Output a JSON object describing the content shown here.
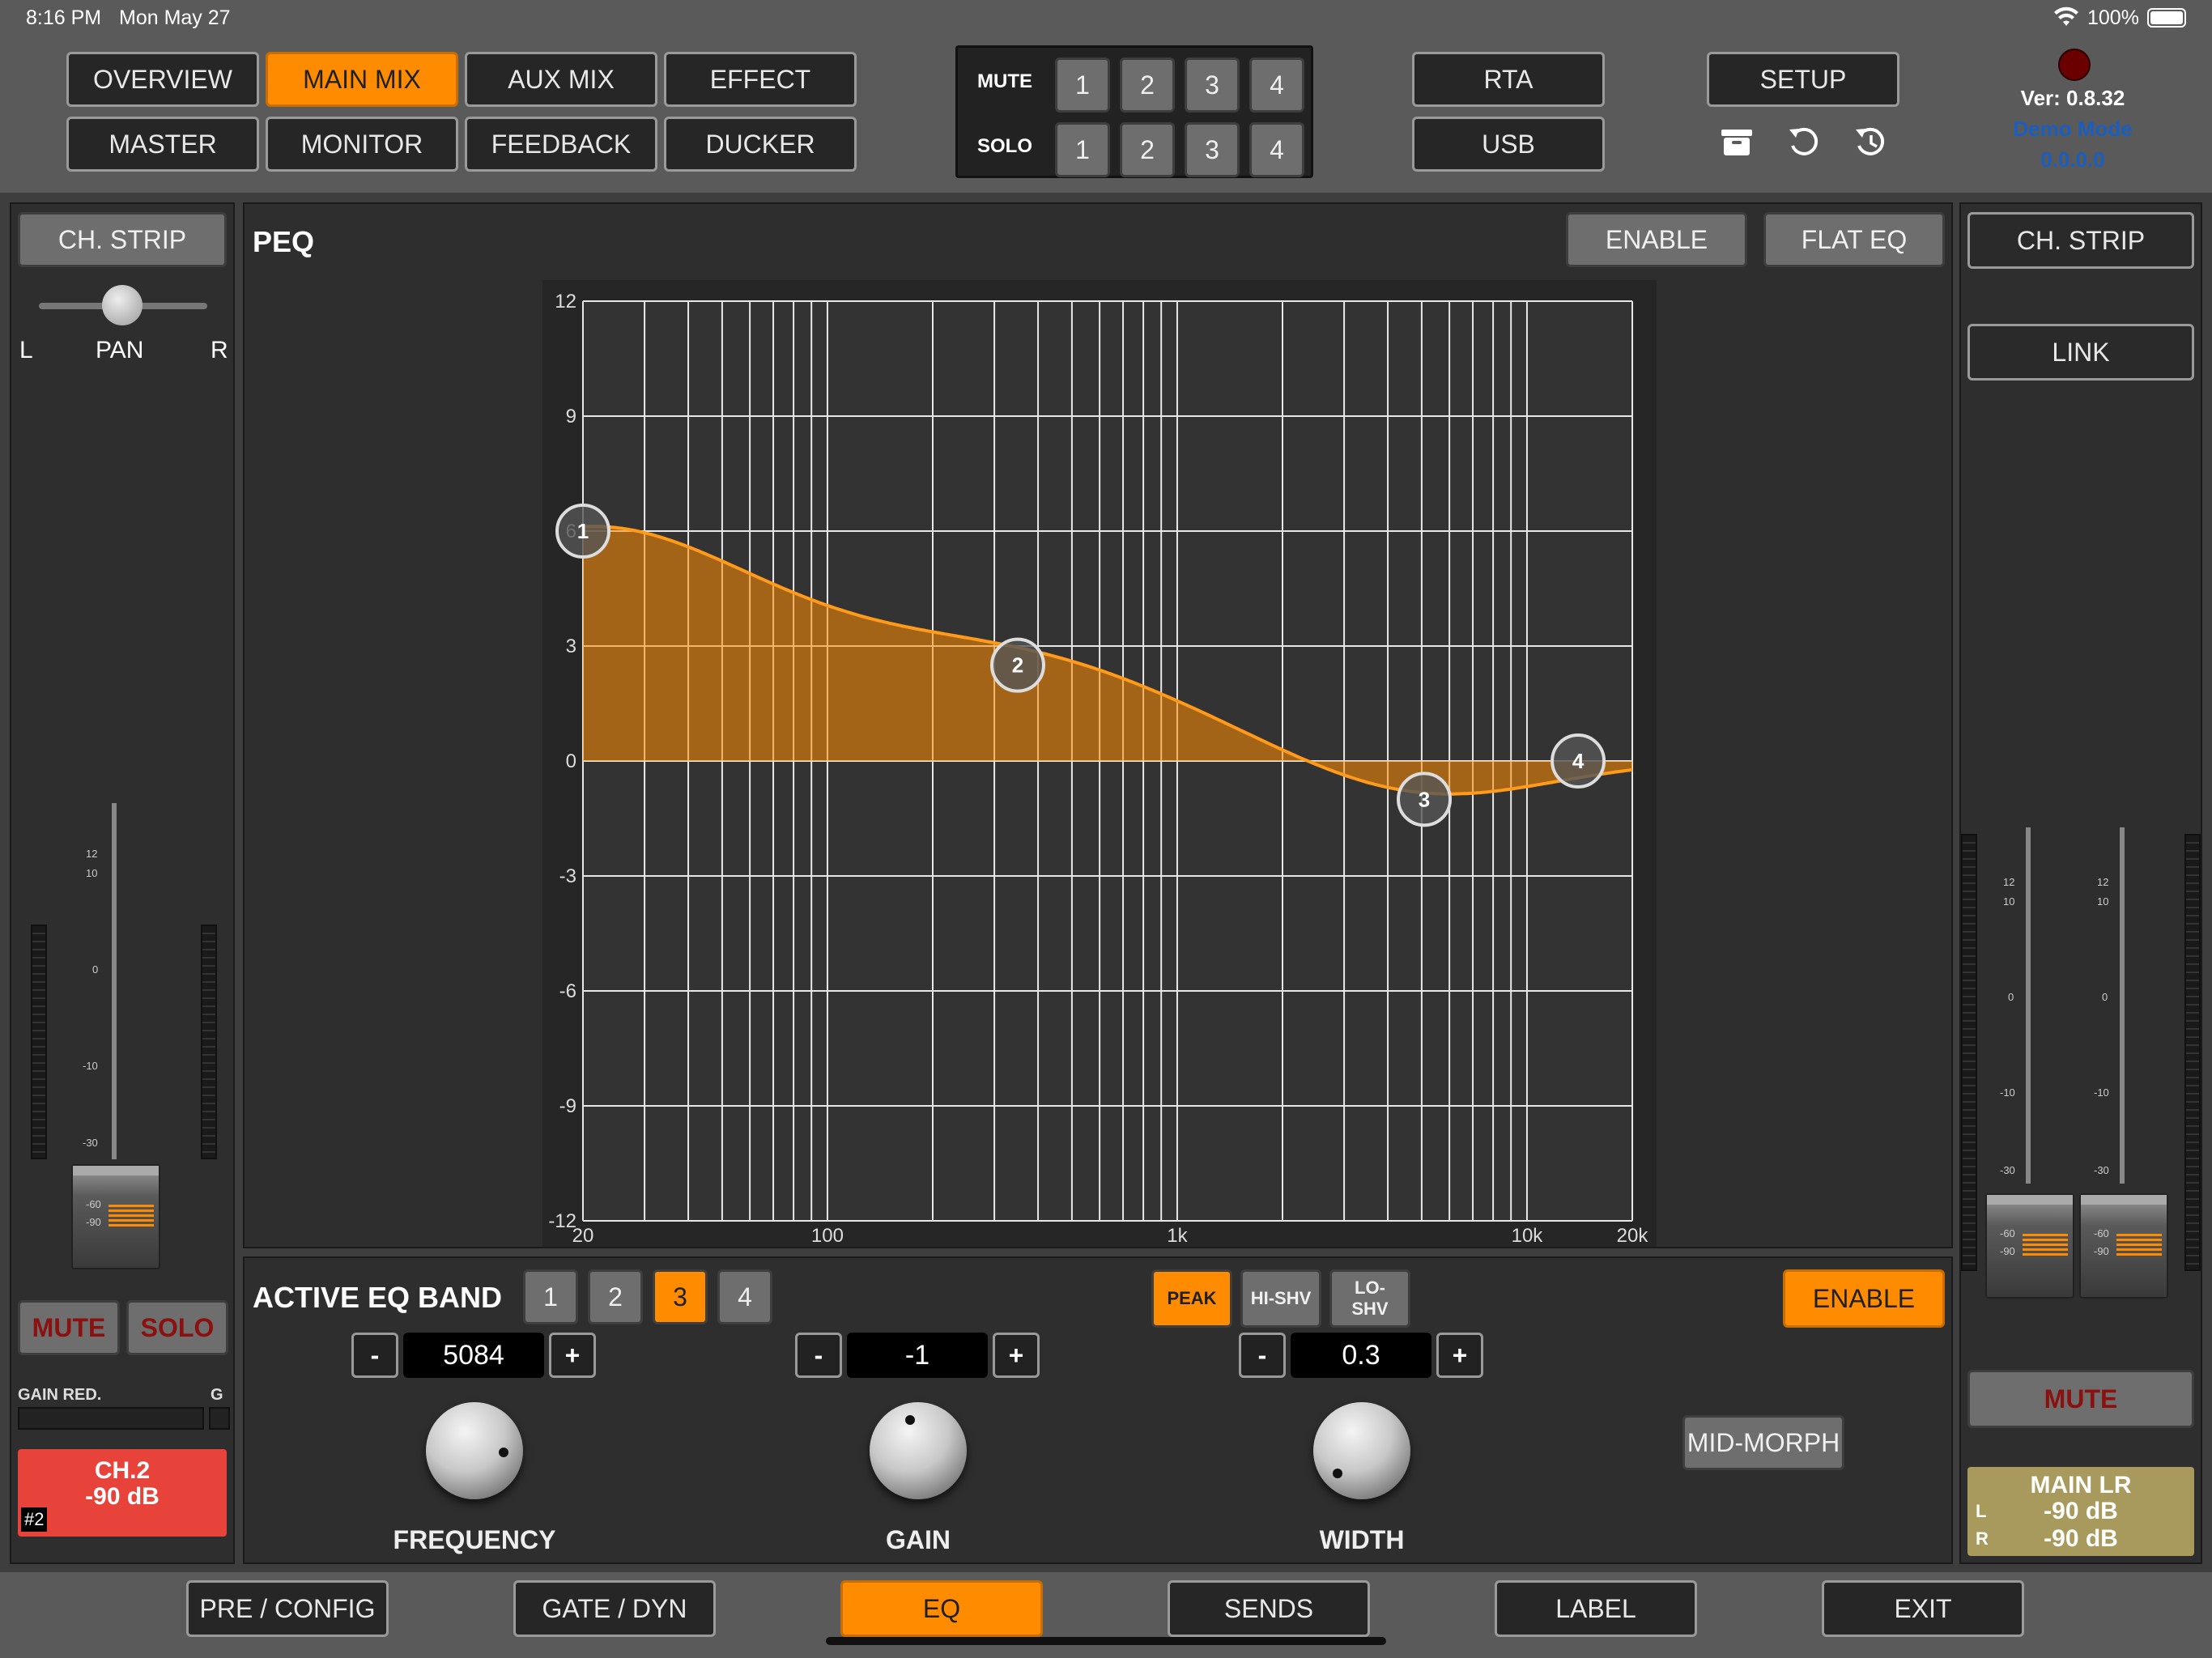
{
  "status_bar": {
    "time": "8:16 PM",
    "date": "Mon May 27",
    "battery": "100%"
  },
  "nav": {
    "row1": [
      "OVERVIEW",
      "MAIN MIX",
      "AUX MIX",
      "EFFECT"
    ],
    "row2": [
      "MASTER",
      "MONITOR",
      "FEEDBACK",
      "DUCKER"
    ],
    "active": "MAIN MIX"
  },
  "mute_solo": {
    "mute_label": "MUTE",
    "solo_label": "SOLO",
    "groups": [
      "1",
      "2",
      "3",
      "4"
    ]
  },
  "right_buttons": {
    "rta": "RTA",
    "usb": "USB",
    "setup": "SETUP"
  },
  "version": {
    "ver": "Ver: 0.8.32",
    "mode": "Demo Mode",
    "ip": "0.0.0.0"
  },
  "left_strip": {
    "ch_strip": "CH. STRIP",
    "pan_l": "L",
    "pan_label": "PAN",
    "pan_r": "R",
    "fader_scale": [
      "12",
      "10",
      "0",
      "-10",
      "-30"
    ],
    "cap_scale": [
      "-60",
      "-90"
    ],
    "mute": "MUTE",
    "solo": "SOLO",
    "gain_red": "GAIN RED.",
    "g": "G",
    "channel_name": "CH.2",
    "channel_level": "-90 dB",
    "channel_num": "#2"
  },
  "peq": {
    "title": "PEQ",
    "enable": "ENABLE",
    "flat_eq": "FLAT EQ",
    "y_ticks": [
      "12",
      "9",
      "6",
      "3",
      "0",
      "-3",
      "-6",
      "-9",
      "-12"
    ],
    "x_ticks": [
      "20",
      "100",
      "1k",
      "10k",
      "20k"
    ],
    "bands": [
      {
        "id": "1",
        "freq_hz": 20,
        "gain_db": 6
      },
      {
        "id": "2",
        "freq_hz": 350,
        "gain_db": 2.5
      },
      {
        "id": "3",
        "freq_hz": 5084,
        "gain_db": -1
      },
      {
        "id": "4",
        "freq_hz": 14000,
        "gain_db": 0
      }
    ]
  },
  "active_band": {
    "title": "ACTIVE EQ BAND",
    "bands": [
      "1",
      "2",
      "3",
      "4"
    ],
    "selected": "3",
    "types": [
      "PEAK",
      "HI-SHV",
      "LO-SHV"
    ],
    "selected_type": "PEAK",
    "enable": "ENABLE",
    "frequency": {
      "value": "5084",
      "label": "FREQUENCY",
      "minus": "-",
      "plus": "+"
    },
    "gain": {
      "value": "-1",
      "label": "GAIN",
      "minus": "-",
      "plus": "+"
    },
    "width": {
      "value": "0.3",
      "label": "WIDTH",
      "minus": "-",
      "plus": "+"
    },
    "mid_morph": "MID-MORPH"
  },
  "right_strip": {
    "ch_strip": "CH. STRIP",
    "link": "LINK",
    "fader_scale": [
      "12",
      "10",
      "0",
      "-10",
      "-30"
    ],
    "cap_scale": [
      "-60",
      "-90"
    ],
    "mute": "MUTE",
    "main_name": "MAIN LR",
    "l_label": "L",
    "l_level": "-90 dB",
    "r_label": "R",
    "r_level": "-90 dB"
  },
  "bottom_tabs": {
    "items": [
      "PRE / CONFIG",
      "GATE / DYN",
      "EQ",
      "SENDS",
      "LABEL",
      "EXIT"
    ],
    "active": "EQ"
  },
  "colors": {
    "accent": "#ff8c00",
    "channel_red": "#e8433a",
    "main_khaki": "#a89a5c",
    "mute_red": "#8b0000"
  }
}
